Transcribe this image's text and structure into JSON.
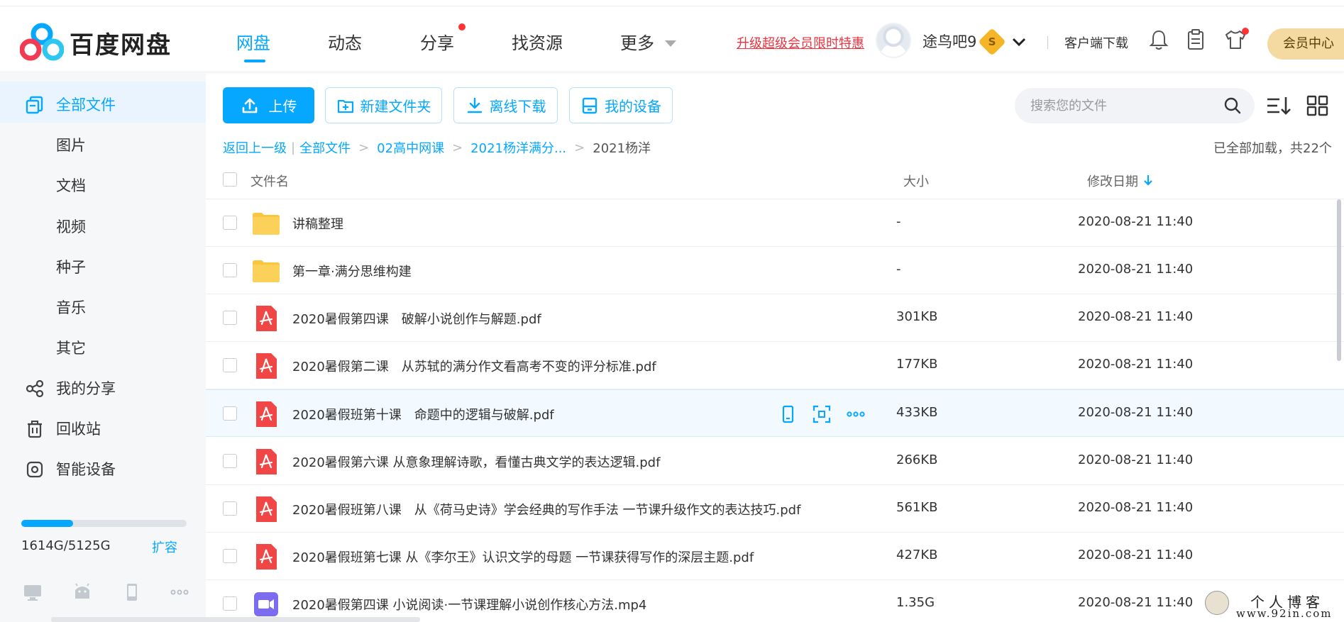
{
  "app": {
    "logo_text": "百度网盘",
    "brand_colors": {
      "accent": "#06a7ff",
      "promo": "#f2313f",
      "vip_gold": "#f4d9a0"
    }
  },
  "nav": {
    "items": [
      {
        "label": "网盘",
        "active": true
      },
      {
        "label": "动态",
        "active": false
      },
      {
        "label": "分享",
        "active": false,
        "badge_dot": true
      },
      {
        "label": "找资源",
        "active": false
      },
      {
        "label": "更多",
        "active": false,
        "has_dropdown": true
      }
    ]
  },
  "header": {
    "promo_link": "升级超级会员限时特惠",
    "username": "途鸟吧9",
    "vip_badge": "S",
    "client_download": "客户端下载",
    "member_center": "会员中心",
    "icons": [
      "bell-icon",
      "clipboard-icon",
      "shirt-icon"
    ]
  },
  "sidebar": {
    "items": [
      {
        "label": "全部文件",
        "icon": "all-files-icon",
        "active": true
      },
      {
        "label": "图片"
      },
      {
        "label": "文档"
      },
      {
        "label": "视频"
      },
      {
        "label": "种子"
      },
      {
        "label": "音乐"
      },
      {
        "label": "其它"
      },
      {
        "label": "我的分享",
        "icon": "share-icon"
      },
      {
        "label": "回收站",
        "icon": "trash-icon"
      },
      {
        "label": "智能设备",
        "icon": "smart-device-icon"
      }
    ],
    "quota": {
      "used": "1614G",
      "total": "5125G",
      "text": "1614G/5125G",
      "used_fraction": 0.315
    },
    "expand_label": "扩容",
    "device_icons": [
      "desktop-icon",
      "android-icon",
      "phone-icon",
      "more-icon"
    ]
  },
  "toolbar": {
    "upload": "上传",
    "new_folder": "新建文件夹",
    "offline_download": "离线下载",
    "my_devices": "我的设备",
    "search_placeholder": "搜索您的文件"
  },
  "breadcrumb": {
    "back": "返回上一级",
    "all_files": "全部文件",
    "path": [
      "02高中网课",
      "2021杨洋满分..."
    ],
    "current": "2021杨洋"
  },
  "loaded_info": "已全部加载，共22个",
  "table": {
    "headers": {
      "name": "文件名",
      "size": "大小",
      "modified": "修改日期"
    },
    "sort": {
      "column": "modified",
      "direction": "desc"
    },
    "rows": [
      {
        "type": "folder",
        "name": "讲稿整理",
        "size": "-",
        "modified": "2020-08-21 11:40"
      },
      {
        "type": "folder",
        "name": "第一章·满分思维构建",
        "size": "-",
        "modified": "2020-08-21 11:40"
      },
      {
        "type": "pdf",
        "name": "2020暑假第四课　破解小说创作与解题.pdf",
        "size": "301KB",
        "modified": "2020-08-21 11:40"
      },
      {
        "type": "pdf",
        "name": "2020暑假第二课　从苏轼的满分作文看高考不变的评分标准.pdf",
        "size": "177KB",
        "modified": "2020-08-21 11:40"
      },
      {
        "type": "pdf",
        "name": "2020暑假班第十课　命题中的逻辑与破解.pdf",
        "size": "433KB",
        "modified": "2020-08-21 11:40",
        "hovered": true
      },
      {
        "type": "pdf",
        "name": "2020暑假第六课 从意象理解诗歌，看懂古典文学的表达逻辑.pdf",
        "size": "266KB",
        "modified": "2020-08-21 11:40"
      },
      {
        "type": "pdf",
        "name": "2020暑假班第八课　从《荷马史诗》学会经典的写作手法 一节课升级作文的表达技巧.pdf",
        "size": "561KB",
        "modified": "2020-08-21 11:40"
      },
      {
        "type": "pdf",
        "name": "2020暑假班第七课 从《李尔王》认识文学的母题 一节课获得写作的深层主题.pdf",
        "size": "427KB",
        "modified": "2020-08-21 11:40"
      },
      {
        "type": "video",
        "name": "2020暑假第四课 小说阅读·一节课理解小说创作核心方法.mp4",
        "size": "1.35G",
        "modified": "2020-08-21 11:40"
      }
    ],
    "row_actions": [
      "send-to-phone-icon",
      "scan-share-icon",
      "more-actions-icon"
    ]
  },
  "watermark": {
    "title": "个人博客",
    "url": "www.92in.com"
  }
}
